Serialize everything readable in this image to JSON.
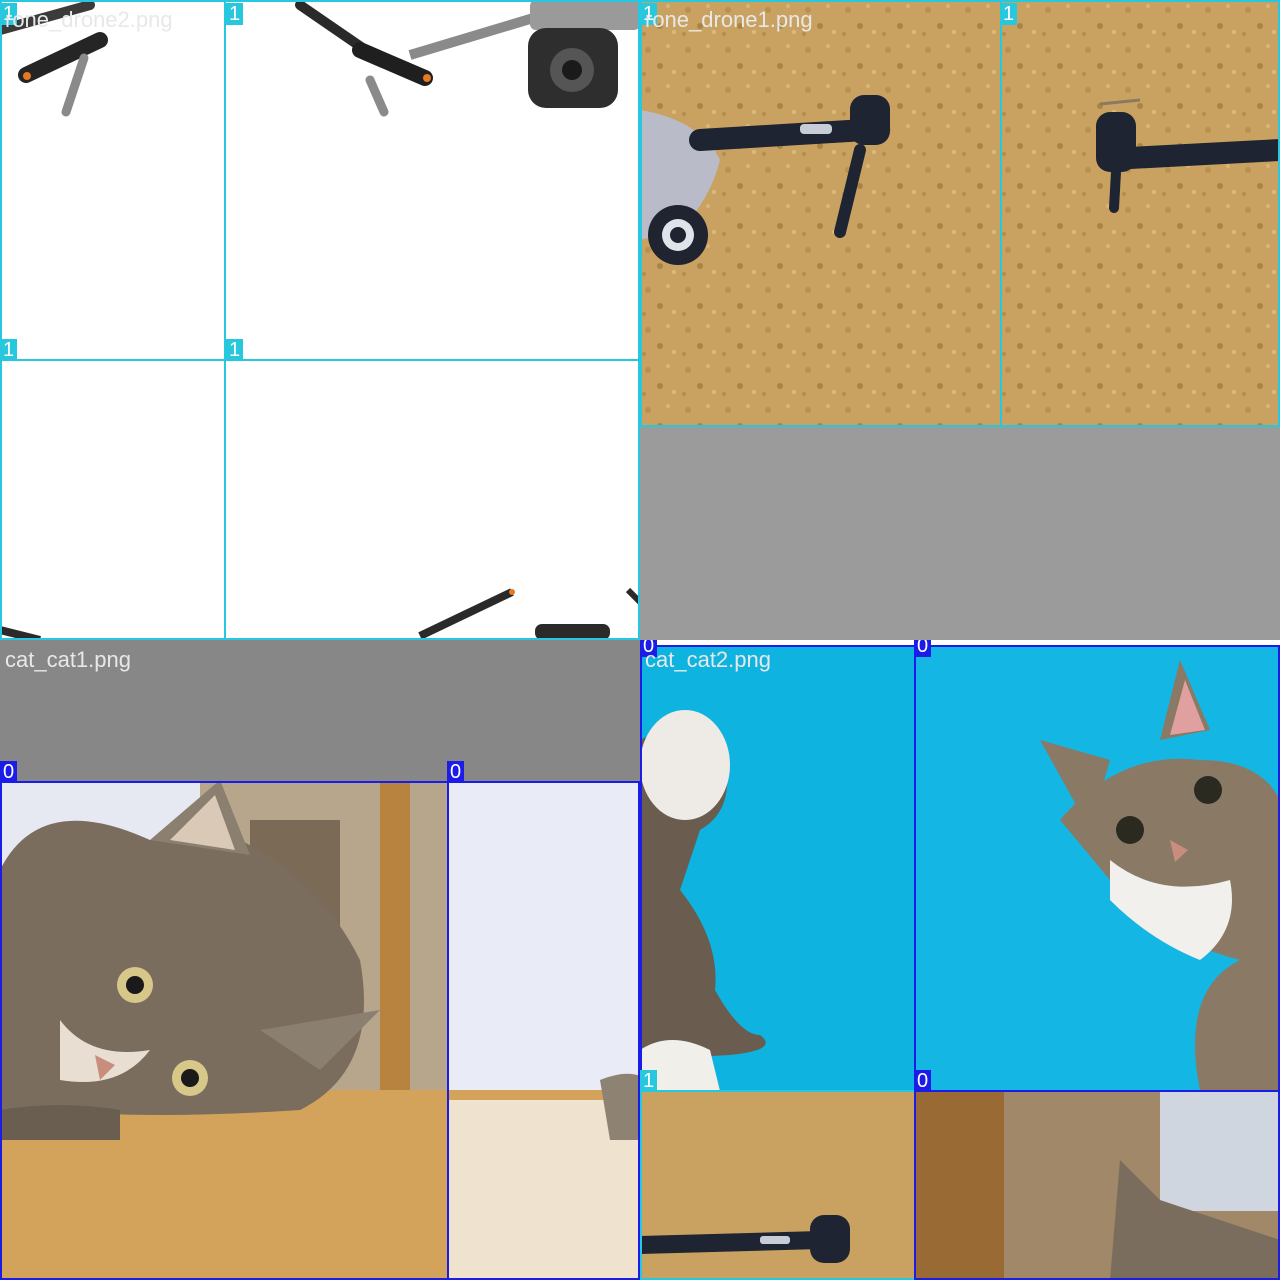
{
  "mosaic": {
    "drone2": {
      "filename": "rone_drone2.png",
      "label": "1"
    },
    "drone1": {
      "filename": "rone_drone1.png",
      "label": "1"
    },
    "cat1": {
      "filename": "cat_cat1.png",
      "label": "0"
    },
    "cat2": {
      "filename": "cat_cat2.png",
      "label": "0"
    },
    "drone_small": {
      "label": "1"
    }
  },
  "colors": {
    "class_1_box": "#27c8dd",
    "class_0_box": "#1c1ce8",
    "padding_gray_top": "#9b9b9b",
    "padding_gray_bottom": "#878787",
    "grass": "#c9a262",
    "sky_blue": "#0fb3e0"
  },
  "icons": [
    "drone-icon",
    "cat-icon"
  ]
}
